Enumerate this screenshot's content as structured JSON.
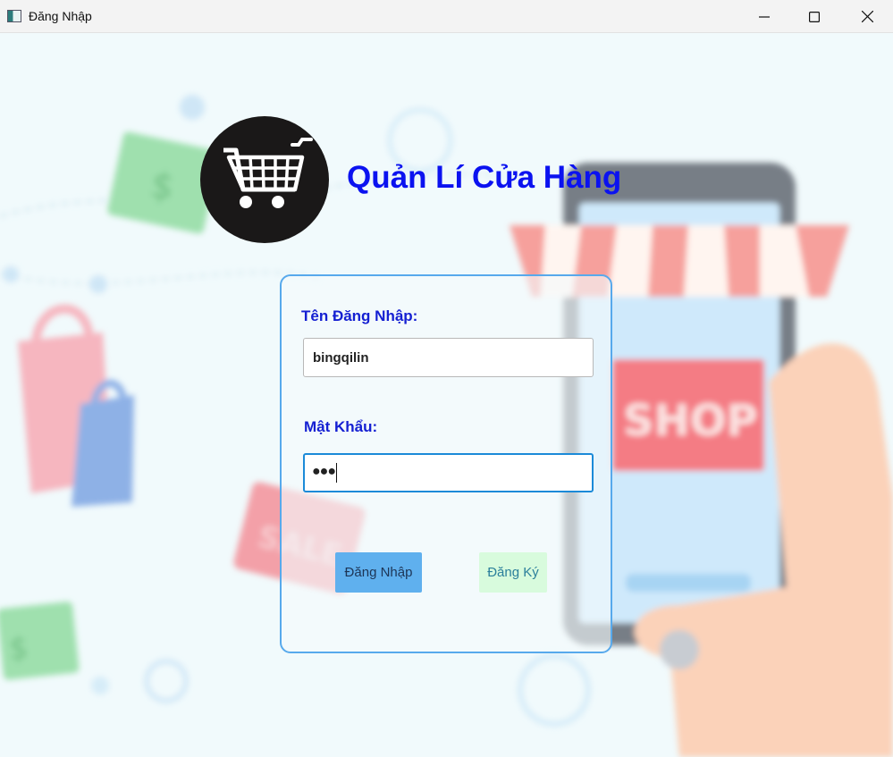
{
  "window": {
    "title": "Đăng Nhập",
    "icon": "app-icon",
    "controls": [
      "minimize-icon",
      "maximize-icon",
      "close-icon"
    ]
  },
  "header": {
    "logo_icon": "shopping-cart-icon",
    "app_title": "Quản Lí Cửa Hàng"
  },
  "background": {
    "illustration": "blurred online shop illustration",
    "sign_text": "SHOP"
  },
  "login_form": {
    "username_label": "Tên Đăng Nhập:",
    "username_value": "bingqilin",
    "password_label": "Mật Khẩu:",
    "password_masked": "●●●",
    "login_button": "Đăng Nhập",
    "register_button": "Đăng Ký"
  },
  "colors": {
    "title": "#0b12f0",
    "label": "#1520d2",
    "panel_border": "#57a9ec",
    "login_button": "#5fb0ee",
    "register_button": "#d8fbdd",
    "logo_bg": "#1a1818"
  }
}
